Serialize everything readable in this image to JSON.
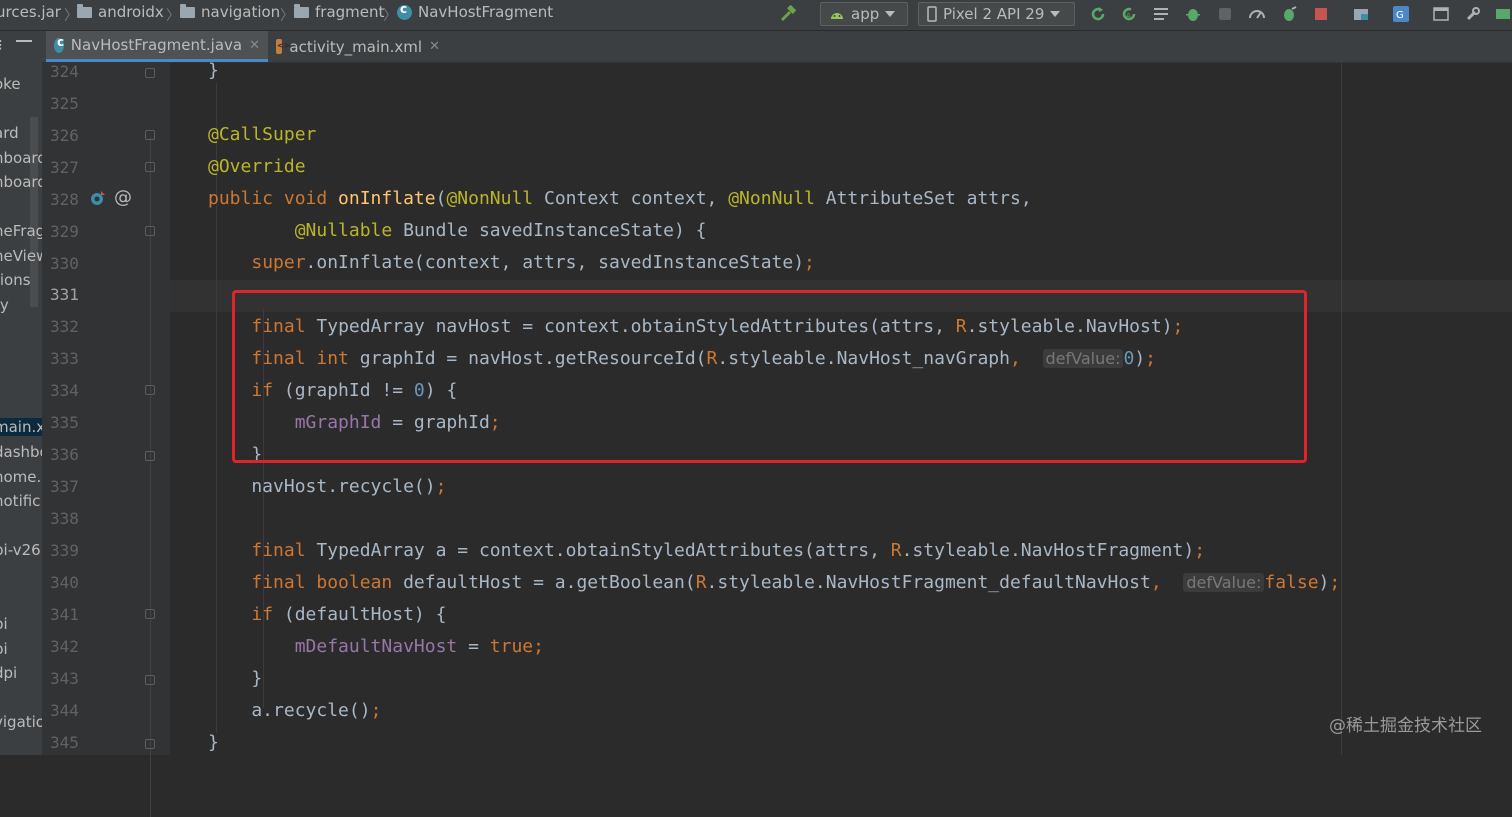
{
  "breadcrumb": {
    "items": [
      "urces.jar",
      "androidx",
      "navigation",
      "fragment",
      "NavHostFragment"
    ]
  },
  "toolbar": {
    "run_config": "app",
    "device": "Pixel 2 API 29"
  },
  "tabs": [
    {
      "label": "NavHostFragment.java",
      "active": true
    },
    {
      "label": "activity_main.xml",
      "active": false
    }
  ],
  "left_panel": {
    "items": [
      "oke",
      "ard",
      "nboard",
      "nboard",
      "neFrag",
      "neView",
      "tions",
      "ty",
      "main.xml",
      "dashbo",
      "home.",
      "notific",
      "pi-v26",
      "i",
      "pi",
      "pi",
      "dpi",
      "vigatio"
    ]
  },
  "editor": {
    "line_numbers": [
      "324",
      "325",
      "326",
      "327",
      "328",
      "329",
      "330",
      "331",
      "332",
      "333",
      "334",
      "335",
      "336",
      "337",
      "338",
      "339",
      "340",
      "341",
      "342",
      "343",
      "344",
      "345"
    ],
    "inlay_hints": [
      "defValue:",
      "defValue:"
    ]
  },
  "watermark": "@稀土掘金技术社区",
  "colors": {
    "highlight_box": "#e0252a",
    "keyword": "#cc7832",
    "annotation": "#bbb529",
    "method": "#ffc66d",
    "field": "#9876aa",
    "number": "#6897bb"
  }
}
